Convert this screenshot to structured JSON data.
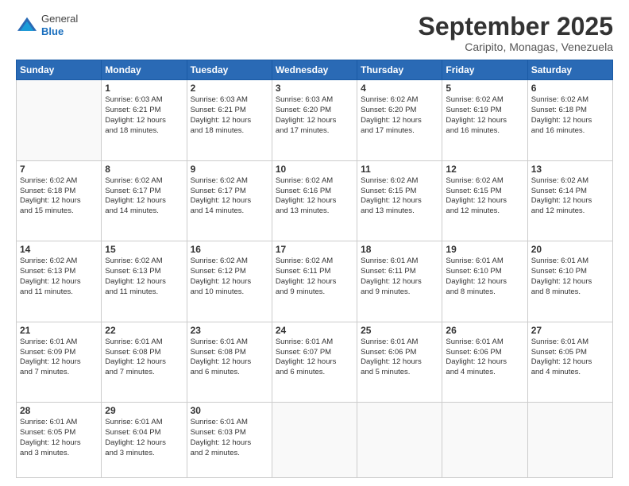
{
  "logo": {
    "general": "General",
    "blue": "Blue"
  },
  "header": {
    "month": "September 2025",
    "location": "Caripito, Monagas, Venezuela"
  },
  "weekdays": [
    "Sunday",
    "Monday",
    "Tuesday",
    "Wednesday",
    "Thursday",
    "Friday",
    "Saturday"
  ],
  "weeks": [
    [
      {
        "day": "",
        "info": ""
      },
      {
        "day": "1",
        "info": "Sunrise: 6:03 AM\nSunset: 6:21 PM\nDaylight: 12 hours\nand 18 minutes."
      },
      {
        "day": "2",
        "info": "Sunrise: 6:03 AM\nSunset: 6:21 PM\nDaylight: 12 hours\nand 18 minutes."
      },
      {
        "day": "3",
        "info": "Sunrise: 6:03 AM\nSunset: 6:20 PM\nDaylight: 12 hours\nand 17 minutes."
      },
      {
        "day": "4",
        "info": "Sunrise: 6:02 AM\nSunset: 6:20 PM\nDaylight: 12 hours\nand 17 minutes."
      },
      {
        "day": "5",
        "info": "Sunrise: 6:02 AM\nSunset: 6:19 PM\nDaylight: 12 hours\nand 16 minutes."
      },
      {
        "day": "6",
        "info": "Sunrise: 6:02 AM\nSunset: 6:18 PM\nDaylight: 12 hours\nand 16 minutes."
      }
    ],
    [
      {
        "day": "7",
        "info": "Sunrise: 6:02 AM\nSunset: 6:18 PM\nDaylight: 12 hours\nand 15 minutes."
      },
      {
        "day": "8",
        "info": "Sunrise: 6:02 AM\nSunset: 6:17 PM\nDaylight: 12 hours\nand 14 minutes."
      },
      {
        "day": "9",
        "info": "Sunrise: 6:02 AM\nSunset: 6:17 PM\nDaylight: 12 hours\nand 14 minutes."
      },
      {
        "day": "10",
        "info": "Sunrise: 6:02 AM\nSunset: 6:16 PM\nDaylight: 12 hours\nand 13 minutes."
      },
      {
        "day": "11",
        "info": "Sunrise: 6:02 AM\nSunset: 6:15 PM\nDaylight: 12 hours\nand 13 minutes."
      },
      {
        "day": "12",
        "info": "Sunrise: 6:02 AM\nSunset: 6:15 PM\nDaylight: 12 hours\nand 12 minutes."
      },
      {
        "day": "13",
        "info": "Sunrise: 6:02 AM\nSunset: 6:14 PM\nDaylight: 12 hours\nand 12 minutes."
      }
    ],
    [
      {
        "day": "14",
        "info": "Sunrise: 6:02 AM\nSunset: 6:13 PM\nDaylight: 12 hours\nand 11 minutes."
      },
      {
        "day": "15",
        "info": "Sunrise: 6:02 AM\nSunset: 6:13 PM\nDaylight: 12 hours\nand 11 minutes."
      },
      {
        "day": "16",
        "info": "Sunrise: 6:02 AM\nSunset: 6:12 PM\nDaylight: 12 hours\nand 10 minutes."
      },
      {
        "day": "17",
        "info": "Sunrise: 6:02 AM\nSunset: 6:11 PM\nDaylight: 12 hours\nand 9 minutes."
      },
      {
        "day": "18",
        "info": "Sunrise: 6:01 AM\nSunset: 6:11 PM\nDaylight: 12 hours\nand 9 minutes."
      },
      {
        "day": "19",
        "info": "Sunrise: 6:01 AM\nSunset: 6:10 PM\nDaylight: 12 hours\nand 8 minutes."
      },
      {
        "day": "20",
        "info": "Sunrise: 6:01 AM\nSunset: 6:10 PM\nDaylight: 12 hours\nand 8 minutes."
      }
    ],
    [
      {
        "day": "21",
        "info": "Sunrise: 6:01 AM\nSunset: 6:09 PM\nDaylight: 12 hours\nand 7 minutes."
      },
      {
        "day": "22",
        "info": "Sunrise: 6:01 AM\nSunset: 6:08 PM\nDaylight: 12 hours\nand 7 minutes."
      },
      {
        "day": "23",
        "info": "Sunrise: 6:01 AM\nSunset: 6:08 PM\nDaylight: 12 hours\nand 6 minutes."
      },
      {
        "day": "24",
        "info": "Sunrise: 6:01 AM\nSunset: 6:07 PM\nDaylight: 12 hours\nand 6 minutes."
      },
      {
        "day": "25",
        "info": "Sunrise: 6:01 AM\nSunset: 6:06 PM\nDaylight: 12 hours\nand 5 minutes."
      },
      {
        "day": "26",
        "info": "Sunrise: 6:01 AM\nSunset: 6:06 PM\nDaylight: 12 hours\nand 4 minutes."
      },
      {
        "day": "27",
        "info": "Sunrise: 6:01 AM\nSunset: 6:05 PM\nDaylight: 12 hours\nand 4 minutes."
      }
    ],
    [
      {
        "day": "28",
        "info": "Sunrise: 6:01 AM\nSunset: 6:05 PM\nDaylight: 12 hours\nand 3 minutes."
      },
      {
        "day": "29",
        "info": "Sunrise: 6:01 AM\nSunset: 6:04 PM\nDaylight: 12 hours\nand 3 minutes."
      },
      {
        "day": "30",
        "info": "Sunrise: 6:01 AM\nSunset: 6:03 PM\nDaylight: 12 hours\nand 2 minutes."
      },
      {
        "day": "",
        "info": ""
      },
      {
        "day": "",
        "info": ""
      },
      {
        "day": "",
        "info": ""
      },
      {
        "day": "",
        "info": ""
      }
    ]
  ]
}
